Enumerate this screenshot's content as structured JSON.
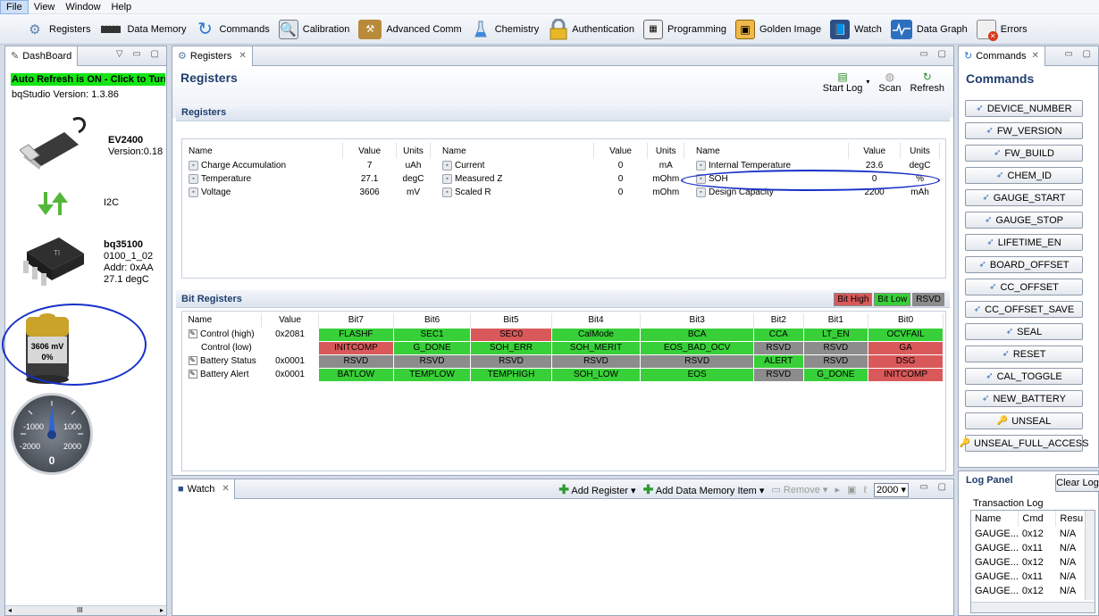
{
  "menu": [
    "File",
    "View",
    "Window",
    "Help"
  ],
  "toolbar": [
    {
      "label": "Registers",
      "icon": "gear-icon"
    },
    {
      "label": "Data Memory",
      "icon": "chip-icon"
    },
    {
      "label": "Commands",
      "icon": "refresh-arrows-icon"
    },
    {
      "label": "Calibration",
      "icon": "magnifier-icon"
    },
    {
      "label": "Advanced Comm",
      "icon": "toolbox-icon"
    },
    {
      "label": "Chemistry",
      "icon": "flask-icon"
    },
    {
      "label": "Authentication",
      "icon": "padlock-icon"
    },
    {
      "label": "Programming",
      "icon": "keypad-icon"
    },
    {
      "label": "Golden Image",
      "icon": "circuit-icon"
    },
    {
      "label": "Watch",
      "icon": "book-icon"
    },
    {
      "label": "Data Graph",
      "icon": "graph-icon"
    },
    {
      "label": "Errors",
      "icon": "error-icon"
    }
  ],
  "dashboard": {
    "tab": "DashBoard",
    "auto_refresh": "Auto Refresh is ON - Click to Turn Off",
    "bqstudio_version": "bqStudio Version:  1.3.86",
    "ev_name": "EV2400",
    "ev_version": "Version:0.18",
    "bus": "I2C",
    "device_name": "bq35100",
    "device_fw": "0100_1_02",
    "device_addr": "Addr: 0xAA",
    "device_temp": "27.1 degC",
    "battery_voltage": "3606 mV",
    "battery_soc": "0%",
    "gauge_ticks": [
      "-1000",
      "1000",
      "-2000",
      "2000"
    ],
    "gauge_value": "0",
    "scroll_thumb": "III"
  },
  "registers": {
    "tab": "Registers",
    "title": "Registers",
    "actions": [
      "Start Log",
      "Scan",
      "Refresh"
    ],
    "section": "Registers",
    "columns": [
      "Name",
      "Value",
      "Units"
    ],
    "groups": [
      [
        {
          "name": "Charge Accumulation",
          "value": "7",
          "units": "uAh"
        },
        {
          "name": "Temperature",
          "value": "27.1",
          "units": "degC"
        },
        {
          "name": "Voltage",
          "value": "3606",
          "units": "mV"
        }
      ],
      [
        {
          "name": "Current",
          "value": "0",
          "units": "mA"
        },
        {
          "name": "Measured Z",
          "value": "0",
          "units": "mOhm"
        },
        {
          "name": "Scaled R",
          "value": "0",
          "units": "mOhm"
        }
      ],
      [
        {
          "name": "Internal Temperature",
          "value": "23.6",
          "units": "degC"
        },
        {
          "name": "SOH",
          "value": "0",
          "units": "%"
        },
        {
          "name": "Design Capacity",
          "value": "2200",
          "units": "mAh"
        }
      ]
    ]
  },
  "bit_registers": {
    "section": "Bit Registers",
    "legend": [
      "Bit High",
      "Bit Low",
      "RSVD"
    ],
    "columns": [
      "Name",
      "Value",
      "Bit7",
      "Bit6",
      "Bit5",
      "Bit4",
      "Bit3",
      "Bit2",
      "Bit1",
      "Bit0"
    ],
    "rows": [
      {
        "name": "Control (high)",
        "value": "0x2081",
        "bits": [
          [
            "FLASHF",
            "g"
          ],
          [
            "SEC1",
            "g"
          ],
          [
            "SEC0",
            "r"
          ],
          [
            "CalMode",
            "g"
          ],
          [
            "BCA",
            "g"
          ],
          [
            "CCA",
            "g"
          ],
          [
            "LT_EN",
            "g"
          ],
          [
            "OCVFAIL",
            "g"
          ]
        ]
      },
      {
        "name": "Control (low)",
        "value": "",
        "bits": [
          [
            "INITCOMP",
            "r"
          ],
          [
            "G_DONE",
            "g"
          ],
          [
            "SOH_ERR",
            "g"
          ],
          [
            "SOH_MERIT",
            "g"
          ],
          [
            "EOS_BAD_OCV",
            "g"
          ],
          [
            "RSVD",
            "s"
          ],
          [
            "RSVD",
            "s"
          ],
          [
            "GA",
            "r"
          ]
        ]
      },
      {
        "name": "Battery Status",
        "value": "0x0001",
        "bits": [
          [
            "RSVD",
            "s"
          ],
          [
            "RSVD",
            "s"
          ],
          [
            "RSVD",
            "s"
          ],
          [
            "RSVD",
            "s"
          ],
          [
            "RSVD",
            "s"
          ],
          [
            "ALERT",
            "g"
          ],
          [
            "RSVD",
            "s"
          ],
          [
            "DSG",
            "r"
          ]
        ]
      },
      {
        "name": "Battery Alert",
        "value": "0x0001",
        "bits": [
          [
            "BATLOW",
            "g"
          ],
          [
            "TEMPLOW",
            "g"
          ],
          [
            "TEMPHIGH",
            "g"
          ],
          [
            "SOH_LOW",
            "g"
          ],
          [
            "EOS",
            "g"
          ],
          [
            "RSVD",
            "s"
          ],
          [
            "G_DONE",
            "g"
          ],
          [
            "INITCOMP",
            "r"
          ]
        ]
      }
    ]
  },
  "watch": {
    "tab": "Watch",
    "add_register": "Add Register",
    "add_dm_item": "Add Data Memory Item",
    "remove": "Remove",
    "interval": "2000"
  },
  "commands": {
    "tab": "Commands",
    "title": "Commands",
    "buttons": [
      "DEVICE_NUMBER",
      "FW_VERSION",
      "FW_BUILD",
      "CHEM_ID",
      "GAUGE_START",
      "GAUGE_STOP",
      "LIFETIME_EN",
      "BOARD_OFFSET",
      "CC_OFFSET",
      "CC_OFFSET_SAVE",
      "SEAL",
      "RESET",
      "CAL_TOGGLE",
      "NEW_BATTERY",
      "UNSEAL",
      "UNSEAL_FULL_ACCESS"
    ]
  },
  "log_panel": {
    "title": "Log Panel",
    "clear": "Clear Log",
    "transaction_label": "Transaction Log",
    "columns": [
      "Name",
      "Cmd",
      "Resu"
    ],
    "rows": [
      [
        "GAUGE...",
        "0x12",
        "N/A"
      ],
      [
        "GAUGE...",
        "0x11",
        "N/A"
      ],
      [
        "GAUGE...",
        "0x12",
        "N/A"
      ],
      [
        "GAUGE...",
        "0x11",
        "N/A"
      ],
      [
        "GAUGE...",
        "0x12",
        "N/A"
      ]
    ]
  },
  "colors": {
    "bit_high": "#d9595b",
    "bit_low": "#38d038",
    "rsvd": "#8c8c8c",
    "auto_refresh": "#14e614",
    "annotation": "#1730c8"
  }
}
